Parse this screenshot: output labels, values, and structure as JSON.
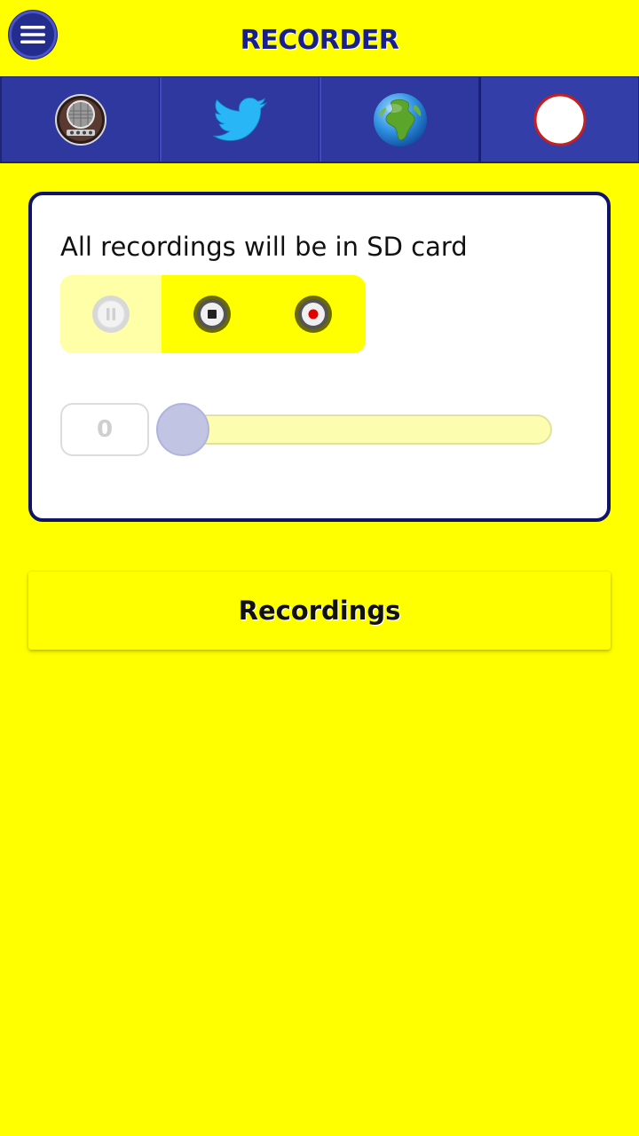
{
  "header": {
    "title": "RECORDER",
    "menu_icon": "hamburger-menu-icon"
  },
  "tabs": [
    {
      "icon": "vintage-radio-icon",
      "active": false
    },
    {
      "icon": "twitter-bird-icon",
      "active": false
    },
    {
      "icon": "globe-icon",
      "active": false
    },
    {
      "icon": "record-circle-icon",
      "active": true
    }
  ],
  "recorder": {
    "storage_note": "All recordings will be in SD card",
    "controls": [
      {
        "icon": "pause-icon",
        "enabled": false
      },
      {
        "icon": "stop-icon",
        "enabled": true
      },
      {
        "icon": "record-icon",
        "enabled": true
      }
    ],
    "counter_value": "0",
    "slider_value": 0
  },
  "recordings_button": {
    "label": "Recordings"
  },
  "colors": {
    "background": "#ffff00",
    "tab_bar": "#2f389e",
    "title": "#1a1f8f",
    "card_border": "#10156a",
    "record_dot": "#e00000"
  }
}
